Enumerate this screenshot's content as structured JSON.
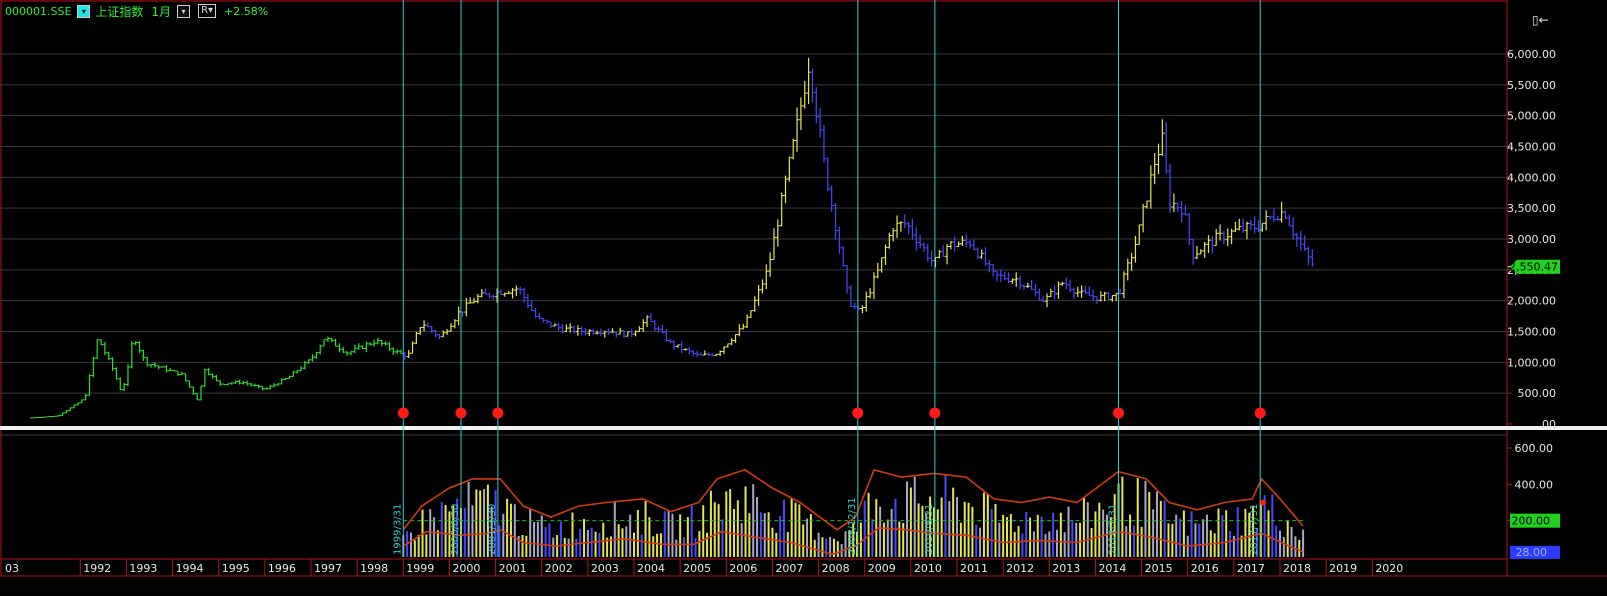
{
  "toolbar": {
    "symbol": "000001.SSE",
    "name": "上证指数",
    "period": "1月",
    "mode_label": "R▾",
    "change": "+2.58%",
    "corner_icon": "▯←"
  },
  "colors": {
    "background": "#000000",
    "grid": "#3a3a3a",
    "axis": "#b31414",
    "early_bars": "#2ee02e",
    "up_bars": "#e6e650",
    "down_bars": "#4848ff",
    "marker_lines": "#33cccc",
    "markers": "#ff1a1a",
    "indicator_line": "#d23a12",
    "dashed_level": "#19c019",
    "price_badge": "#1ed21e",
    "low_badge": "#2b3cff"
  },
  "chart_data": [
    {
      "type": "candlestick",
      "title": "",
      "y_axis_ticks": [
        "6,000.00",
        "5,500.00",
        "5,000.00",
        "4,500.00",
        "4,000.00",
        "3,500.00",
        "3,000.00",
        "2,500.00",
        "2,000.00",
        "1,500.00",
        "1,000.00",
        "500.00",
        ".00"
      ],
      "ylim": [
        0,
        6000
      ],
      "last_price_label": "2,550.47",
      "last_price": 2550.47,
      "monthly_close_path": [
        {
          "x": 1990.95,
          "y": 100
        },
        {
          "x": 1991.5,
          "y": 130
        },
        {
          "x": 1991.85,
          "y": 290
        },
        {
          "x": 1992.1,
          "y": 420
        },
        {
          "x": 1992.38,
          "y": 1400
        },
        {
          "x": 1992.7,
          "y": 900
        },
        {
          "x": 1992.9,
          "y": 500
        },
        {
          "x": 1993.05,
          "y": 950
        },
        {
          "x": 1993.15,
          "y": 1450
        },
        {
          "x": 1993.4,
          "y": 1000
        },
        {
          "x": 1993.8,
          "y": 900
        },
        {
          "x": 1994.2,
          "y": 800
        },
        {
          "x": 1994.55,
          "y": 380
        },
        {
          "x": 1994.7,
          "y": 900
        },
        {
          "x": 1995.0,
          "y": 650
        },
        {
          "x": 1995.5,
          "y": 680
        },
        {
          "x": 1996.0,
          "y": 560
        },
        {
          "x": 1996.5,
          "y": 750
        },
        {
          "x": 1997.0,
          "y": 1050
        },
        {
          "x": 1997.3,
          "y": 1400
        },
        {
          "x": 1997.8,
          "y": 1150
        },
        {
          "x": 1998.4,
          "y": 1350
        },
        {
          "x": 1998.9,
          "y": 1150
        },
        {
          "x": 1999.1,
          "y": 1100
        },
        {
          "x": 1999.4,
          "y": 1650
        },
        {
          "x": 1999.8,
          "y": 1400
        },
        {
          "x": 2000.2,
          "y": 1800
        },
        {
          "x": 2000.6,
          "y": 2050
        },
        {
          "x": 2001.1,
          "y": 2150
        },
        {
          "x": 2001.5,
          "y": 2200
        },
        {
          "x": 2001.9,
          "y": 1700
        },
        {
          "x": 2002.4,
          "y": 1550
        },
        {
          "x": 2002.9,
          "y": 1500
        },
        {
          "x": 2003.4,
          "y": 1520
        },
        {
          "x": 2003.9,
          "y": 1450
        },
        {
          "x": 2004.3,
          "y": 1700
        },
        {
          "x": 2004.8,
          "y": 1300
        },
        {
          "x": 2005.4,
          "y": 1100
        },
        {
          "x": 2005.8,
          "y": 1150
        },
        {
          "x": 2006.4,
          "y": 1600
        },
        {
          "x": 2006.9,
          "y": 2500
        },
        {
          "x": 2007.2,
          "y": 3600
        },
        {
          "x": 2007.5,
          "y": 4700
        },
        {
          "x": 2007.8,
          "y": 5900
        },
        {
          "x": 2008.1,
          "y": 4300
        },
        {
          "x": 2008.4,
          "y": 3100
        },
        {
          "x": 2008.65,
          "y": 2000
        },
        {
          "x": 2008.9,
          "y": 1800
        },
        {
          "x": 2009.3,
          "y": 2500
        },
        {
          "x": 2009.6,
          "y": 3200
        },
        {
          "x": 2009.9,
          "y": 3250
        },
        {
          "x": 2010.5,
          "y": 2600
        },
        {
          "x": 2010.8,
          "y": 2900
        },
        {
          "x": 2011.3,
          "y": 2950
        },
        {
          "x": 2011.8,
          "y": 2400
        },
        {
          "x": 2012.3,
          "y": 2350
        },
        {
          "x": 2012.9,
          "y": 2000
        },
        {
          "x": 2013.3,
          "y": 2300
        },
        {
          "x": 2013.7,
          "y": 2100
        },
        {
          "x": 2014.1,
          "y": 2050
        },
        {
          "x": 2014.5,
          "y": 2100
        },
        {
          "x": 2014.9,
          "y": 3000
        },
        {
          "x": 2015.3,
          "y": 4300
        },
        {
          "x": 2015.45,
          "y": 4600
        },
        {
          "x": 2015.6,
          "y": 3600
        },
        {
          "x": 2015.9,
          "y": 3500
        },
        {
          "x": 2016.1,
          "y": 2750
        },
        {
          "x": 2016.6,
          "y": 3000
        },
        {
          "x": 2017.1,
          "y": 3150
        },
        {
          "x": 2017.5,
          "y": 3200
        },
        {
          "x": 2017.9,
          "y": 3400
        },
        {
          "x": 2018.1,
          "y": 3450
        },
        {
          "x": 2018.3,
          "y": 3100
        },
        {
          "x": 2018.6,
          "y": 2700
        },
        {
          "x": 2018.75,
          "y": 2550
        }
      ],
      "marker_dates": [
        1999.0,
        2000.25,
        2001.05,
        2008.85,
        2010.52,
        2014.5,
        2017.57
      ]
    },
    {
      "type": "bar",
      "title": "",
      "y_axis_ticks": [
        "600.00",
        "400.00",
        "200.00"
      ],
      "dashed_level_label": "200.00",
      "low_level_label": "28.00",
      "vertical_date_labels": [
        "1999/3/31",
        "2000/6/30",
        "2001/3/30",
        "2008/12/31",
        "2010/8/31",
        "2014/7/31",
        "2017/7/31"
      ],
      "indicator_upper": [
        {
          "x": 1999.0,
          "y": 150
        },
        {
          "x": 1999.4,
          "y": 280
        },
        {
          "x": 2000.0,
          "y": 380
        },
        {
          "x": 2000.5,
          "y": 430
        },
        {
          "x": 2001.1,
          "y": 430
        },
        {
          "x": 2001.6,
          "y": 280
        },
        {
          "x": 2002.2,
          "y": 220
        },
        {
          "x": 2002.8,
          "y": 280
        },
        {
          "x": 2003.4,
          "y": 300
        },
        {
          "x": 2004.2,
          "y": 320
        },
        {
          "x": 2004.8,
          "y": 250
        },
        {
          "x": 2005.4,
          "y": 300
        },
        {
          "x": 2005.8,
          "y": 430
        },
        {
          "x": 2006.4,
          "y": 480
        },
        {
          "x": 2007.0,
          "y": 380
        },
        {
          "x": 2007.6,
          "y": 300
        },
        {
          "x": 2008.4,
          "y": 150
        },
        {
          "x": 2008.8,
          "y": 220
        },
        {
          "x": 2009.2,
          "y": 480
        },
        {
          "x": 2009.8,
          "y": 440
        },
        {
          "x": 2010.5,
          "y": 460
        },
        {
          "x": 2011.2,
          "y": 440
        },
        {
          "x": 2011.8,
          "y": 320
        },
        {
          "x": 2012.4,
          "y": 300
        },
        {
          "x": 2013.0,
          "y": 330
        },
        {
          "x": 2013.6,
          "y": 300
        },
        {
          "x": 2014.5,
          "y": 470
        },
        {
          "x": 2015.1,
          "y": 430
        },
        {
          "x": 2015.6,
          "y": 300
        },
        {
          "x": 2016.2,
          "y": 260
        },
        {
          "x": 2016.8,
          "y": 300
        },
        {
          "x": 2017.4,
          "y": 320
        },
        {
          "x": 2017.6,
          "y": 430
        },
        {
          "x": 2018.0,
          "y": 320
        },
        {
          "x": 2018.5,
          "y": 170
        }
      ],
      "indicator_lower": [
        {
          "x": 1999.0,
          "y": 60
        },
        {
          "x": 1999.5,
          "y": 140
        },
        {
          "x": 2000.2,
          "y": 120
        },
        {
          "x": 2000.8,
          "y": 130
        },
        {
          "x": 2001.1,
          "y": 150
        },
        {
          "x": 2001.6,
          "y": 80
        },
        {
          "x": 2002.3,
          "y": 60
        },
        {
          "x": 2003.0,
          "y": 80
        },
        {
          "x": 2003.8,
          "y": 100
        },
        {
          "x": 2004.6,
          "y": 70
        },
        {
          "x": 2005.3,
          "y": 70
        },
        {
          "x": 2005.9,
          "y": 140
        },
        {
          "x": 2006.6,
          "y": 110
        },
        {
          "x": 2007.4,
          "y": 80
        },
        {
          "x": 2008.3,
          "y": 15
        },
        {
          "x": 2008.8,
          "y": 60
        },
        {
          "x": 2009.3,
          "y": 160
        },
        {
          "x": 2009.9,
          "y": 150
        },
        {
          "x": 2010.5,
          "y": 130
        },
        {
          "x": 2011.2,
          "y": 120
        },
        {
          "x": 2012.0,
          "y": 80
        },
        {
          "x": 2012.8,
          "y": 90
        },
        {
          "x": 2013.6,
          "y": 80
        },
        {
          "x": 2014.5,
          "y": 140
        },
        {
          "x": 2015.2,
          "y": 110
        },
        {
          "x": 2016.0,
          "y": 60
        },
        {
          "x": 2016.8,
          "y": 80
        },
        {
          "x": 2017.6,
          "y": 130
        },
        {
          "x": 2018.2,
          "y": 60
        },
        {
          "x": 2018.5,
          "y": 28
        }
      ]
    }
  ],
  "time_axis": {
    "leading_label": "03",
    "years": [
      "1992",
      "1993",
      "1994",
      "1995",
      "1996",
      "1997",
      "1998",
      "1999",
      "2000",
      "2001",
      "2002",
      "2003",
      "2004",
      "2005",
      "2006",
      "2007",
      "2008",
      "2009",
      "2010",
      "2011",
      "2012",
      "2013",
      "2014",
      "2015",
      "2016",
      "2017",
      "2018",
      "2019",
      "2020"
    ]
  }
}
